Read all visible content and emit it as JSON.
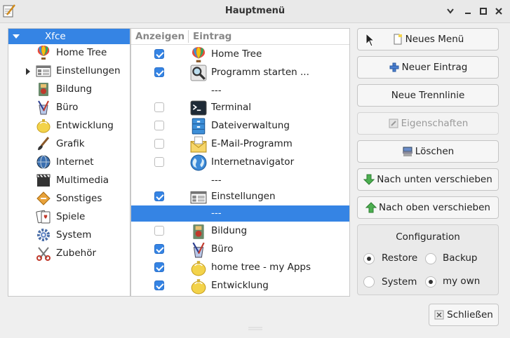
{
  "window": {
    "title": "Hauptmenü"
  },
  "tree": {
    "root": "Xfce",
    "items": [
      {
        "label": "Home Tree",
        "icon": "balloon-icon"
      },
      {
        "label": "Einstellungen",
        "icon": "settings-icon",
        "expandable": true
      },
      {
        "label": "Bildung",
        "icon": "education-icon"
      },
      {
        "label": "Büro",
        "icon": "office-icon"
      },
      {
        "label": "Entwicklung",
        "icon": "development-icon"
      },
      {
        "label": "Grafik",
        "icon": "graphics-icon"
      },
      {
        "label": "Internet",
        "icon": "internet-icon"
      },
      {
        "label": "Multimedia",
        "icon": "multimedia-icon"
      },
      {
        "label": "Sonstiges",
        "icon": "other-icon"
      },
      {
        "label": "Spiele",
        "icon": "games-icon"
      },
      {
        "label": "System",
        "icon": "system-icon"
      },
      {
        "label": "Zubehör",
        "icon": "accessories-icon"
      }
    ]
  },
  "list": {
    "columns": [
      "Anzeigen",
      "Eintrag"
    ],
    "rows": [
      {
        "checked": true,
        "label": "Home Tree",
        "icon": "balloon-icon"
      },
      {
        "checked": true,
        "label": "Programm starten ...",
        "icon": "search-icon"
      },
      {
        "separator": true,
        "label": "---"
      },
      {
        "checked": false,
        "label": "Terminal",
        "icon": "terminal-icon"
      },
      {
        "checked": false,
        "label": "Dateiverwaltung",
        "icon": "file-manager-icon"
      },
      {
        "checked": false,
        "label": "E-Mail-Programm",
        "icon": "mail-icon"
      },
      {
        "checked": false,
        "label": "Internetnavigator",
        "icon": "globe-icon"
      },
      {
        "separator": true,
        "label": "---"
      },
      {
        "checked": true,
        "label": "Einstellungen",
        "icon": "settings-icon"
      },
      {
        "separator": true,
        "label": "---",
        "selected": true
      },
      {
        "checked": false,
        "label": "Bildung",
        "icon": "education-icon"
      },
      {
        "checked": true,
        "label": "Büro",
        "icon": "office-icon"
      },
      {
        "checked": true,
        "label": "home tree - my Apps",
        "icon": "development-icon"
      },
      {
        "checked": true,
        "label": "Entwicklung",
        "icon": "development-icon"
      }
    ]
  },
  "buttons": {
    "new_menu": "Neues Menü",
    "new_entry": "Neuer Eintrag",
    "new_separator": "Neue Trennlinie",
    "properties": "Eigenschaften",
    "delete": "Löschen",
    "move_down": "Nach unten verschieben",
    "move_up": "Nach oben verschieben",
    "close": "Schließen"
  },
  "config": {
    "title": "Configuration",
    "options": [
      {
        "label": "Restore",
        "selected": true
      },
      {
        "label": "Backup",
        "selected": false
      },
      {
        "label": "System",
        "selected": false
      },
      {
        "label": "my own",
        "selected": true
      }
    ]
  },
  "colors": {
    "accent": "#3584e4"
  }
}
